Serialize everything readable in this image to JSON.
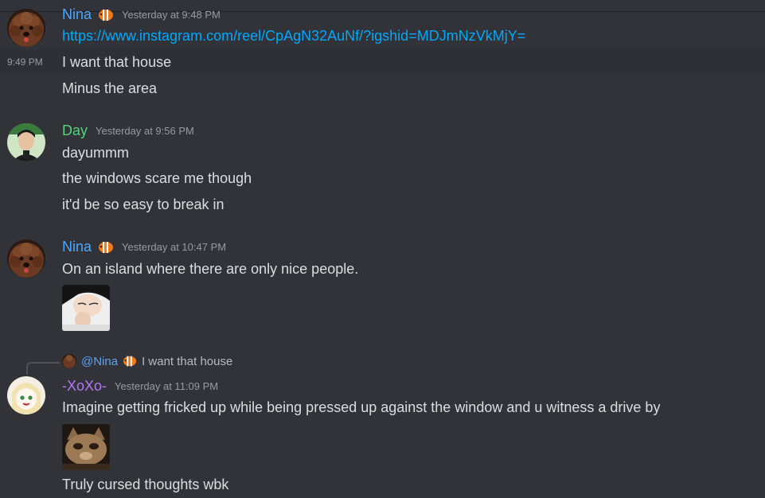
{
  "messages": [
    {
      "author": "Nina",
      "author_color": "#4da6ff",
      "timestamp": "Yesterday at 9:48 PM",
      "badge_icon": "clownfish-icon",
      "lines": [
        "https://www.instagram.com/reel/CpAgN32AuNf/?igshid=MDJmNzVkMjY=",
        "I want that house",
        "Minus the area"
      ],
      "hover_time": "9:49 PM"
    },
    {
      "author": "Day",
      "author_color": "#57d37a",
      "timestamp": "Yesterday at 9:56 PM",
      "lines": [
        "dayummm",
        "the windows scare me though",
        "it'd be so easy to break in"
      ]
    },
    {
      "author": "Nina",
      "author_color": "#4da6ff",
      "timestamp": "Yesterday at 10:47 PM",
      "badge_icon": "clownfish-icon",
      "lines": [
        "On an island where there are only nice people."
      ]
    },
    {
      "reply": {
        "mention": "@Nina",
        "text": "I want that house"
      },
      "author": "-XoXo-",
      "author_color": "#b277f5",
      "timestamp": "Yesterday at 11:09 PM",
      "lines": [
        "Imagine getting fricked up while being pressed up against the window and u witness a drive by",
        "Truly cursed thoughts wbk"
      ]
    }
  ]
}
